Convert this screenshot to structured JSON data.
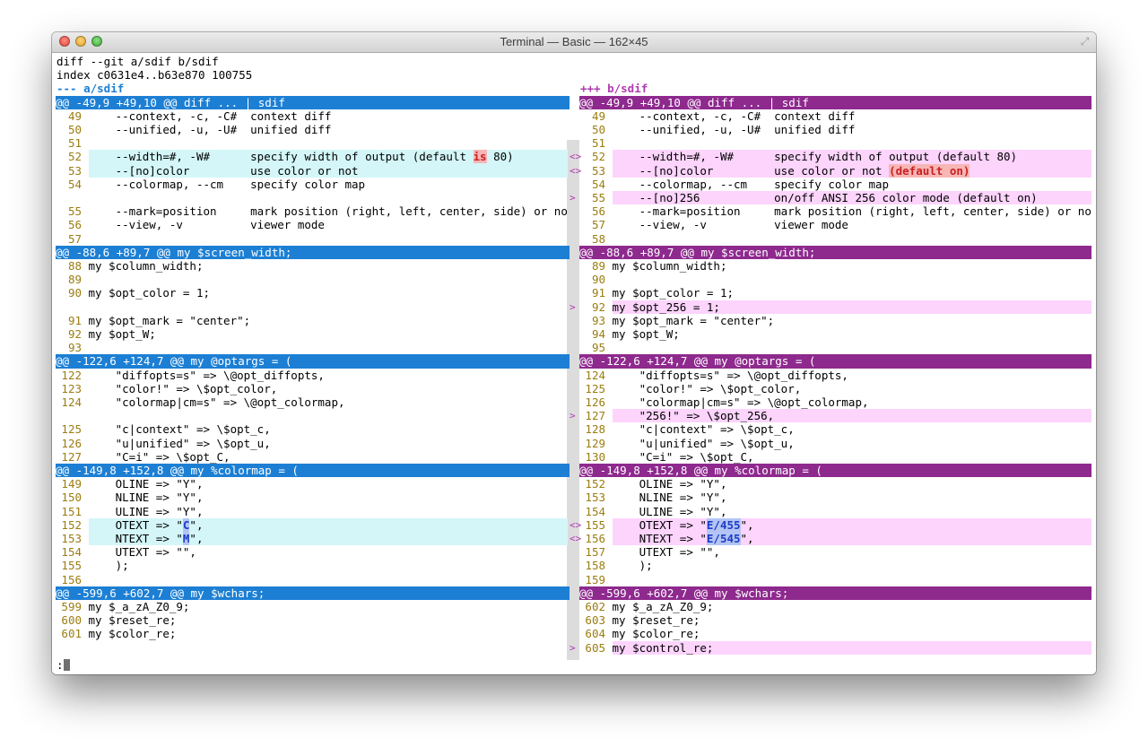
{
  "window": {
    "title": "Terminal — Basic — 162×45"
  },
  "top_lines": [
    "diff --git a/sdif b/sdif",
    "index c0631e4..b63e870 100755"
  ],
  "file_header": {
    "left": "--- a/sdif",
    "right": "+++ b/sdif"
  },
  "hunks": [
    {
      "header_left": "@@ -49,9 +49,10 @@ diff ... | sdif",
      "header_right": "@@ -49,9 +49,10 @@ diff ... | sdif",
      "lines": [
        {
          "l": {
            "n": "49",
            "t": "    --context, -c, -C#  context diff"
          },
          "r": {
            "n": "49",
            "t": "    --context, -c, -C#  context diff"
          }
        },
        {
          "l": {
            "n": "50",
            "t": "    --unified, -u, -U#  unified diff"
          },
          "r": {
            "n": "50",
            "t": "    --unified, -u, -U#  unified diff"
          }
        },
        {
          "l": {
            "n": "51",
            "t": ""
          },
          "r": {
            "n": "51",
            "t": ""
          }
        },
        {
          "mark": "<>",
          "l": {
            "n": "52",
            "t": "    --width=#, -W#      specify width of output (default ",
            "hl": "is",
            "hlc": "red",
            "post": " 80)",
            "bg": true
          },
          "r": {
            "n": "52",
            "t": "    --width=#, -W#      specify width of output (default 80)",
            "bg": true
          }
        },
        {
          "mark": "<>",
          "l": {
            "n": "53",
            "t": "    --[no]color         use color or not",
            "bg": true
          },
          "r": {
            "n": "53",
            "t": "    --[no]color         use color or not ",
            "hl": "(default on)",
            "hlc": "red",
            "post": "",
            "bg": true
          }
        },
        {
          "l": {
            "n": "54",
            "t": "    --colormap, --cm    specify color map"
          },
          "r": {
            "n": "54",
            "t": "    --colormap, --cm    specify color map"
          }
        },
        {
          "mark": ">",
          "l": null,
          "r": {
            "n": "55",
            "t": "    --[no]256           on/off ANSI 256 color mode (default on)",
            "bg": true
          }
        },
        {
          "l": {
            "n": "55",
            "t": "    --mark=position     mark position (right, left, center, side) or no"
          },
          "r": {
            "n": "56",
            "t": "    --mark=position     mark position (right, left, center, side) or no"
          }
        },
        {
          "l": {
            "n": "56",
            "t": "    --view, -v          viewer mode"
          },
          "r": {
            "n": "57",
            "t": "    --view, -v          viewer mode"
          }
        },
        {
          "l": {
            "n": "57",
            "t": ""
          },
          "r": {
            "n": "58",
            "t": ""
          }
        }
      ]
    },
    {
      "header_left": "@@ -88,6 +89,7 @@ my $screen_width;",
      "header_right": "@@ -88,6 +89,7 @@ my $screen_width;",
      "lines": [
        {
          "l": {
            "n": "88",
            "t": "my $column_width;"
          },
          "r": {
            "n": "89",
            "t": "my $column_width;"
          }
        },
        {
          "l": {
            "n": "89",
            "t": ""
          },
          "r": {
            "n": "90",
            "t": ""
          }
        },
        {
          "l": {
            "n": "90",
            "t": "my $opt_color = 1;"
          },
          "r": {
            "n": "91",
            "t": "my $opt_color = 1;"
          }
        },
        {
          "mark": ">",
          "l": null,
          "r": {
            "n": "92",
            "t": "my $opt_256 = 1;",
            "bg": true
          }
        },
        {
          "l": {
            "n": "91",
            "t": "my $opt_mark = \"center\";"
          },
          "r": {
            "n": "93",
            "t": "my $opt_mark = \"center\";"
          }
        },
        {
          "l": {
            "n": "92",
            "t": "my $opt_W;"
          },
          "r": {
            "n": "94",
            "t": "my $opt_W;"
          }
        },
        {
          "l": {
            "n": "93",
            "t": ""
          },
          "r": {
            "n": "95",
            "t": ""
          }
        }
      ]
    },
    {
      "header_left": "@@ -122,6 +124,7 @@ my @optargs = (",
      "header_right": "@@ -122,6 +124,7 @@ my @optargs = (",
      "lines": [
        {
          "l": {
            "n": "122",
            "t": "    \"diffopts=s\" => \\@opt_diffopts,"
          },
          "r": {
            "n": "124",
            "t": "    \"diffopts=s\" => \\@opt_diffopts,"
          }
        },
        {
          "l": {
            "n": "123",
            "t": "    \"color!\" => \\$opt_color,"
          },
          "r": {
            "n": "125",
            "t": "    \"color!\" => \\$opt_color,"
          }
        },
        {
          "l": {
            "n": "124",
            "t": "    \"colormap|cm=s\" => \\@opt_colormap,"
          },
          "r": {
            "n": "126",
            "t": "    \"colormap|cm=s\" => \\@opt_colormap,"
          }
        },
        {
          "mark": ">",
          "l": null,
          "r": {
            "n": "127",
            "t": "    \"256!\" => \\$opt_256,",
            "bg": true
          }
        },
        {
          "l": {
            "n": "125",
            "t": "    \"c|context\" => \\$opt_c,"
          },
          "r": {
            "n": "128",
            "t": "    \"c|context\" => \\$opt_c,"
          }
        },
        {
          "l": {
            "n": "126",
            "t": "    \"u|unified\" => \\$opt_u,"
          },
          "r": {
            "n": "129",
            "t": "    \"u|unified\" => \\$opt_u,"
          }
        },
        {
          "l": {
            "n": "127",
            "t": "    \"C=i\" => \\$opt_C,"
          },
          "r": {
            "n": "130",
            "t": "    \"C=i\" => \\$opt_C,"
          }
        }
      ]
    },
    {
      "header_left": "@@ -149,8 +152,8 @@ my %colormap = (",
      "header_right": "@@ -149,8 +152,8 @@ my %colormap = (",
      "lines": [
        {
          "l": {
            "n": "149",
            "t": "    OLINE => \"Y\","
          },
          "r": {
            "n": "152",
            "t": "    OLINE => \"Y\","
          }
        },
        {
          "l": {
            "n": "150",
            "t": "    NLINE => \"Y\","
          },
          "r": {
            "n": "153",
            "t": "    NLINE => \"Y\","
          }
        },
        {
          "l": {
            "n": "151",
            "t": "    ULINE => \"Y\","
          },
          "r": {
            "n": "154",
            "t": "    ULINE => \"Y\","
          }
        },
        {
          "mark": "<>",
          "l": {
            "n": "152",
            "t": "    OTEXT => \"",
            "hl": "C",
            "hlc": "blue",
            "post": "\",",
            "bg": true
          },
          "r": {
            "n": "155",
            "t": "    OTEXT => \"",
            "hl": "E/455",
            "hlc": "blue",
            "post": "\",",
            "bg": true
          }
        },
        {
          "mark": "<>",
          "l": {
            "n": "153",
            "t": "    NTEXT => \"",
            "hl": "M",
            "hlc": "blue",
            "post": "\",",
            "bg": true
          },
          "r": {
            "n": "156",
            "t": "    NTEXT => \"",
            "hl": "E/545",
            "hlc": "blue",
            "post": "\",",
            "bg": true
          }
        },
        {
          "l": {
            "n": "154",
            "t": "    UTEXT => \"\","
          },
          "r": {
            "n": "157",
            "t": "    UTEXT => \"\","
          }
        },
        {
          "l": {
            "n": "155",
            "t": "    );"
          },
          "r": {
            "n": "158",
            "t": "    );"
          }
        },
        {
          "l": {
            "n": "156",
            "t": ""
          },
          "r": {
            "n": "159",
            "t": ""
          }
        }
      ]
    },
    {
      "header_left": "@@ -599,6 +602,7 @@ my $wchars;",
      "header_right": "@@ -599,6 +602,7 @@ my $wchars;",
      "lines": [
        {
          "l": {
            "n": "599",
            "t": "my $_a_zA_Z0_9;"
          },
          "r": {
            "n": "602",
            "t": "my $_a_zA_Z0_9;"
          }
        },
        {
          "l": {
            "n": "600",
            "t": "my $reset_re;"
          },
          "r": {
            "n": "603",
            "t": "my $reset_re;"
          }
        },
        {
          "l": {
            "n": "601",
            "t": "my $color_re;"
          },
          "r": {
            "n": "604",
            "t": "my $color_re;"
          }
        },
        {
          "mark": ">",
          "l": null,
          "r": {
            "n": "605",
            "t": "my $control_re;",
            "bg": true
          }
        }
      ]
    }
  ],
  "prompt": ":",
  "colors": {
    "left_header": "#1c7fd4",
    "right_header": "#8e298e",
    "left_changed_bg": "#d4f6f8",
    "right_changed_bg": "#fcd4fc",
    "line_number": "#9b7d10"
  },
  "icons": {
    "resize": "fullscreen-arrows-icon"
  }
}
